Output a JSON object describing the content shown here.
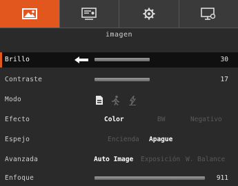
{
  "tabs": [
    {
      "name": "image-tab",
      "icon": "image-icon",
      "active": true
    },
    {
      "name": "display-tab",
      "icon": "presentation-icon",
      "active": false
    },
    {
      "name": "settings-tab",
      "icon": "gear-icon",
      "active": false
    },
    {
      "name": "monitor-tab",
      "icon": "monitor-icon",
      "active": false
    }
  ],
  "page_title": "imagen",
  "rows": {
    "brillo": {
      "label": "Brillo",
      "value": "30",
      "level": 0.3
    },
    "contraste": {
      "label": "Contraste",
      "value": "17",
      "level": 0.17
    },
    "modo": {
      "label": "Modo",
      "icons": [
        "document-icon",
        "running-person-icon",
        "flash-icon"
      ]
    },
    "efecto": {
      "label": "Efecto",
      "options": [
        "Color",
        "BW",
        "Negativo"
      ],
      "selected": "Color"
    },
    "espejo": {
      "label": "Espejo",
      "options": [
        "Encienda",
        "Apague"
      ],
      "selected": "Apague"
    },
    "avanzada": {
      "label": "Avanzada",
      "options": [
        "Auto Image",
        "Exposición",
        "W. Balance"
      ],
      "selected": "Auto Image"
    },
    "enfoque": {
      "label": "Enfoque",
      "value": "911"
    }
  },
  "colors": {
    "accent": "#e2571e",
    "background": "#2a2a2a",
    "selected_row": "#101010",
    "disabled_text": "#5a5a5a"
  }
}
